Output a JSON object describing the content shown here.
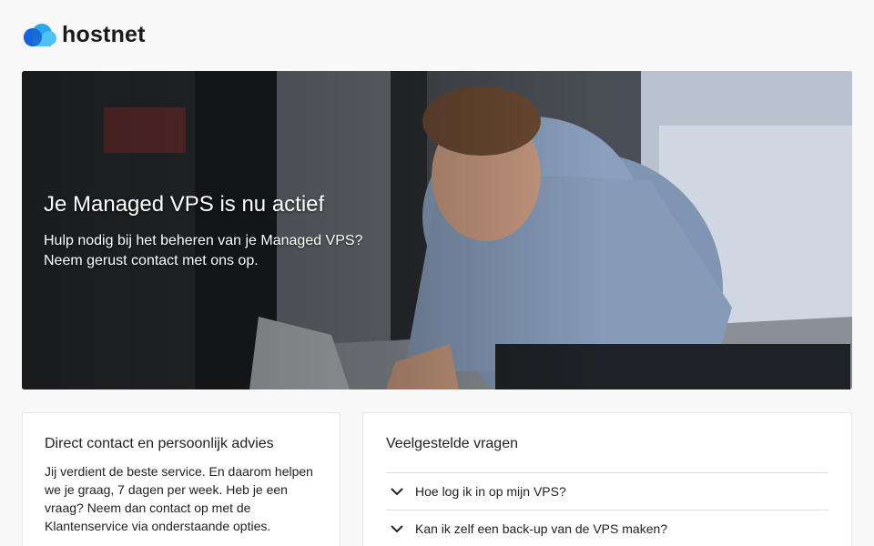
{
  "header": {
    "logo_text": "hostnet"
  },
  "hero": {
    "title": "Je Managed VPS is nu actief",
    "subtitle_line1": "Hulp nodig bij het beheren van je Managed VPS?",
    "subtitle_line2": "Neem gerust contact met ons op."
  },
  "contact": {
    "title": "Direct contact en persoonlijk advies",
    "text": "Jij verdient de beste service. En daarom helpen we je graag, 7 dagen per week. Heb je een vraag? Neem dan contact op met de Klantenservice via onderstaande opties."
  },
  "faq": {
    "title": "Veelgestelde vragen",
    "items": [
      {
        "question": "Hoe log ik in op mijn VPS?",
        "icon": "chevron-down-icon"
      },
      {
        "question": "Kan ik zelf een back-up van de VPS maken?",
        "icon": "chevron-down-icon"
      }
    ]
  },
  "colors": {
    "logo_blue_dark": "#1a6fd6",
    "logo_blue_light": "#4fc3f7",
    "text_dark": "#1f1f1f",
    "page_bg": "#f8f8f8"
  }
}
